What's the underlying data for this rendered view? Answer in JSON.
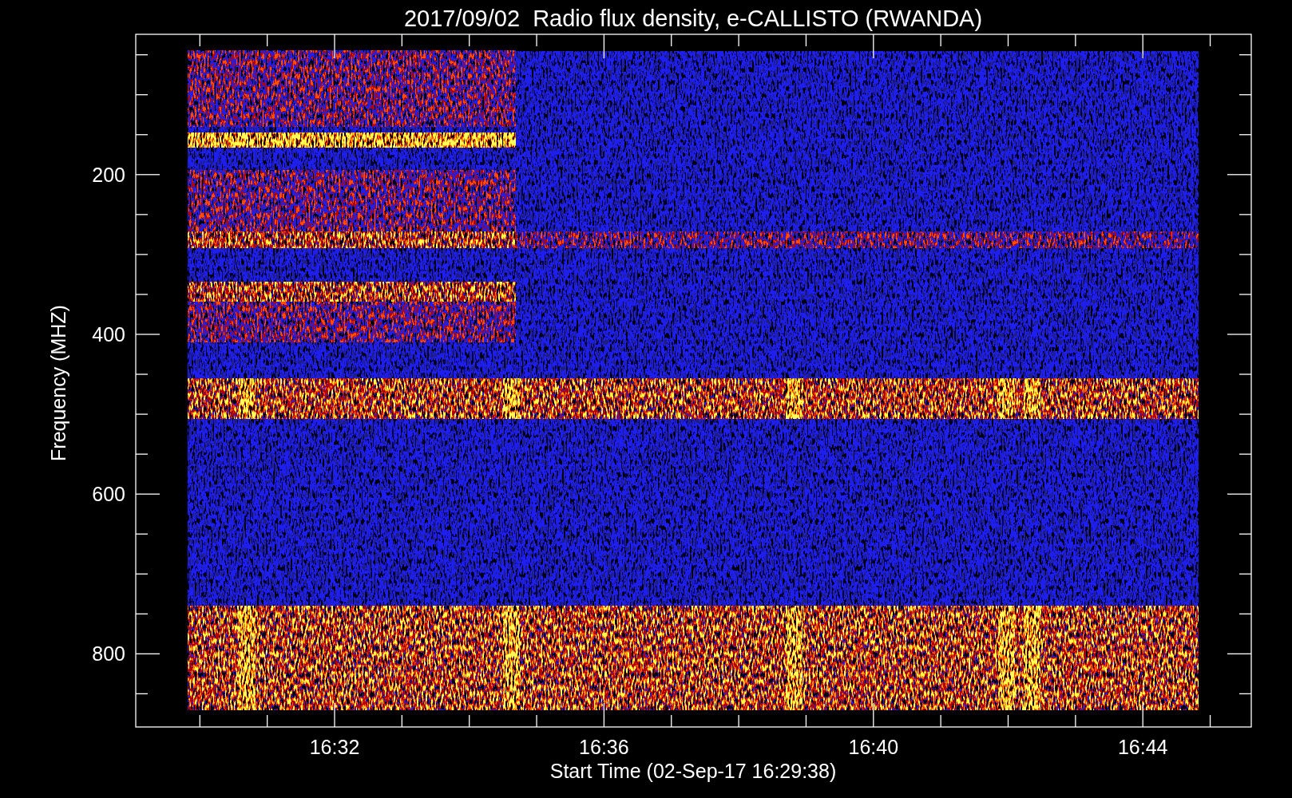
{
  "plot": {
    "title": "2017/09/02  Radio flux density, e-CALLISTO (RWANDA)",
    "xlabel": "Start Time (02-Sep-17 16:29:38)",
    "ylabel": "Frequency (MHZ)",
    "xticks": [
      "16:32",
      "16:36",
      "16:40",
      "16:44"
    ],
    "yticks": [
      "200",
      "400",
      "600",
      "800"
    ]
  }
}
